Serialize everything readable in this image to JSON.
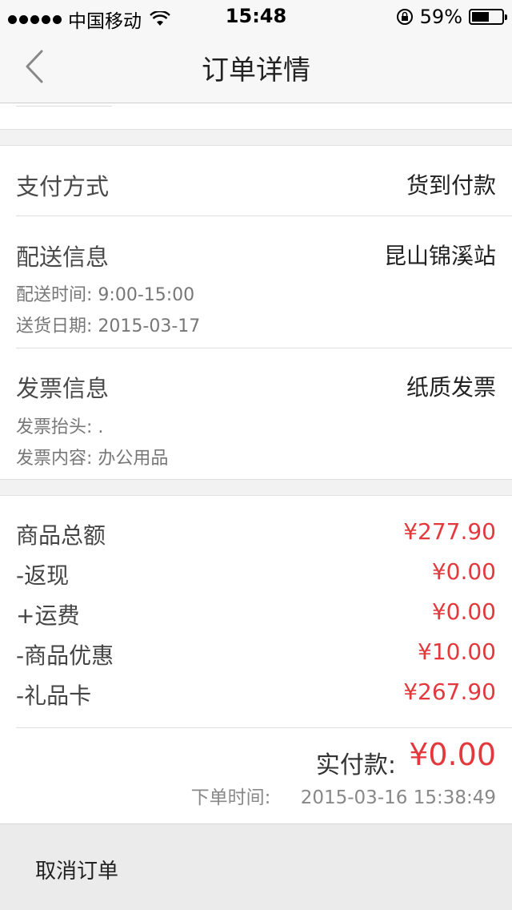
{
  "status_bar": {
    "carrier": "中国移动",
    "time": "15:48",
    "battery": "59%",
    "battery_level": 0.59
  },
  "nav": {
    "title": "订单详情"
  },
  "payment": {
    "label": "支付方式",
    "value": "货到付款"
  },
  "delivery": {
    "label": "配送信息",
    "value": "昆山锦溪站",
    "time_label": "配送时间:",
    "time_value": "9:00-15:00",
    "date_label": "送货日期:",
    "date_value": "2015-03-17"
  },
  "invoice": {
    "label": "发票信息",
    "value": "纸质发票",
    "title_label": "发票抬头:",
    "title_value": ".",
    "content_label": "发票内容:",
    "content_value": "办公用品"
  },
  "amounts": [
    {
      "label": "商品总额",
      "value": "¥277.90"
    },
    {
      "label": "-返现",
      "value": "¥0.00"
    },
    {
      "label": "+运费",
      "value": "¥0.00"
    },
    {
      "label": "-商品优惠",
      "value": "¥10.00"
    },
    {
      "label": "-礼品卡",
      "value": "¥267.90"
    }
  ],
  "summary": {
    "paid_label": "实付款:",
    "paid_value": "¥0.00",
    "order_time_label": "下单时间:",
    "order_time_value": "2015-03-16 15:38:49"
  },
  "footer": {
    "cancel_label": "取消订单"
  },
  "colors": {
    "accent_red": "#e4393c"
  }
}
